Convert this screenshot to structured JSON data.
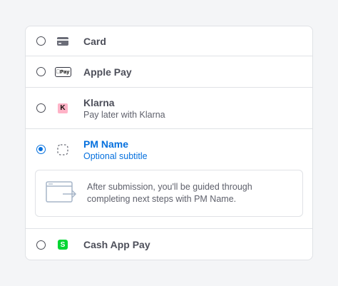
{
  "payment_methods": [
    {
      "label": "Card",
      "icon": "credit-card-icon"
    },
    {
      "label": "Apple Pay",
      "icon": "apple-pay-icon",
      "badge": "Pay"
    },
    {
      "label": "Klarna",
      "subtitle": "Pay later with Klarna",
      "icon": "klarna-icon",
      "badge": "K"
    },
    {
      "label": "PM Name",
      "subtitle": "Optional subtitle",
      "icon": "placeholder-icon",
      "selected": true
    },
    {
      "label": "Cash App Pay",
      "icon": "cash-app-icon",
      "badge": "S"
    }
  ],
  "notice": {
    "text": "After submission, you'll be guided through completing next steps with PM Name.",
    "icon": "redirect-icon"
  },
  "colors": {
    "accent": "#0570de",
    "klarna": "#ffb3c7",
    "cash_app": "#00d632",
    "border": "#e0e2e6",
    "background": "#f4f5f7"
  }
}
